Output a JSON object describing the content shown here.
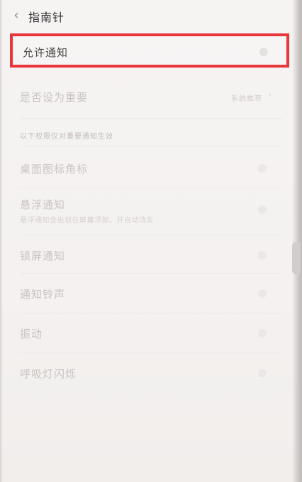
{
  "header": {
    "back_icon": "chevron-left-icon",
    "title": "指南针"
  },
  "allow_notifications": {
    "label": "允许通知",
    "enabled": false,
    "highlight_color": "#e9363a"
  },
  "importance": {
    "label": "是否设为重要",
    "value": "系统推荐"
  },
  "section_caption": "以下权限仅对重要通知生效",
  "settings": [
    {
      "label": "桌面图标角标"
    },
    {
      "label": "悬浮通知",
      "sub": "悬浮通知会出现在屏幕顶部，并自动消失"
    },
    {
      "label": "锁屏通知"
    },
    {
      "label": "通知铃声"
    },
    {
      "label": "振动"
    },
    {
      "label": "呼吸灯闪烁"
    }
  ]
}
